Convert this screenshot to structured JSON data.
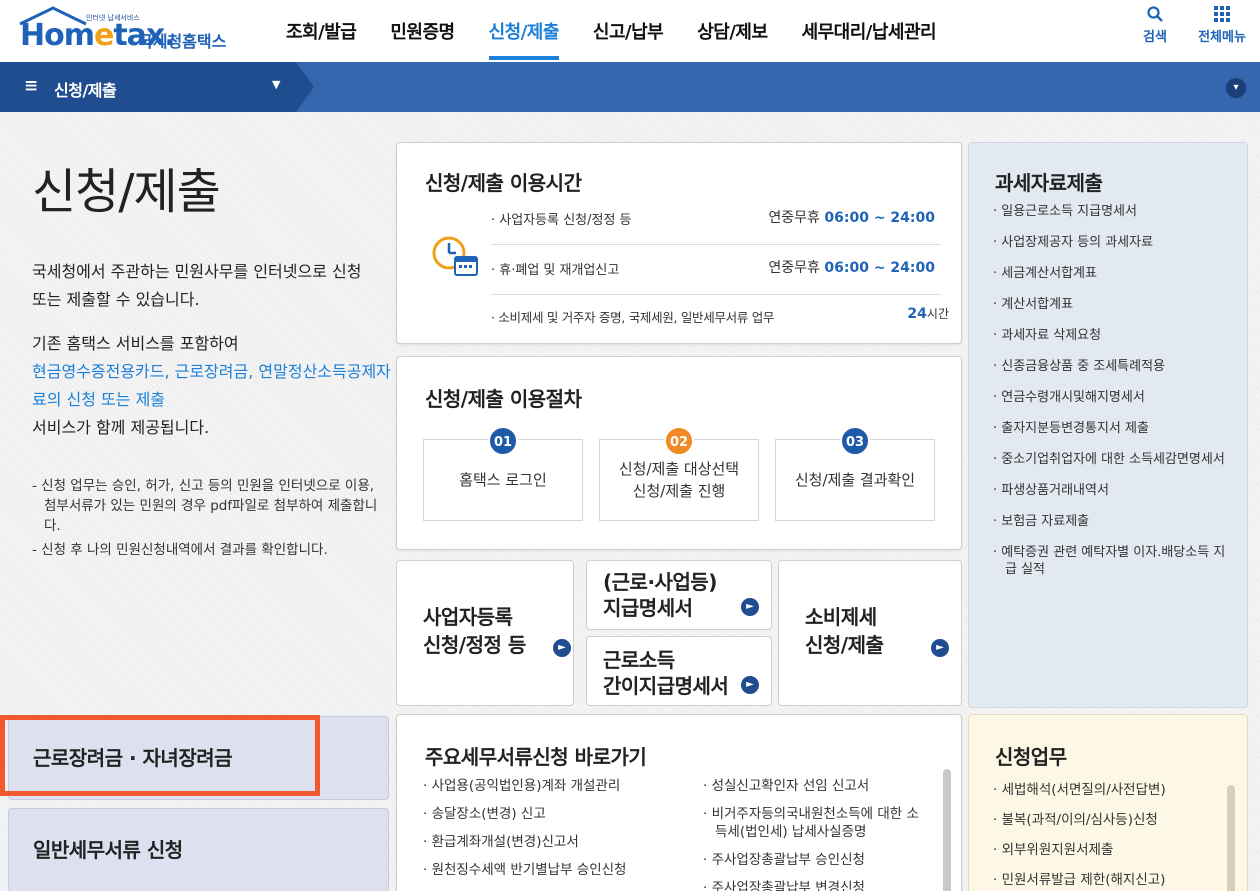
{
  "logo": {
    "tagline": "인터넷 납세서비스",
    "word_a": "Hom",
    "word_e": "e",
    "word_b": "tax.",
    "korean": "국세청홈택스"
  },
  "nav": {
    "items": [
      "조회/발급",
      "민원증명",
      "신청/제출",
      "신고/납부",
      "상담/제보",
      "세무대리/납세관리"
    ],
    "active_index": 2
  },
  "util": {
    "search": "검색",
    "all_menu": "전체메뉴"
  },
  "subbar": {
    "title": "신청/제출"
  },
  "intro": {
    "heading": "신청/제출",
    "p1": "국세청에서 주관하는 민원사무를 인터넷으로 신청 또는 제출할 수 있습니다.",
    "p2_pre": "기존 홈택스 서비스를 포함하여",
    "p2_blue": "현금영수증전용카드, 근로장려금, 연말정산소득공제자료의 신청 또는 제출",
    "p2_post": "서비스가 함께 제공됩니다.",
    "notes": [
      "- 신청 업무는 승인, 허가, 신고 등의 민원을 인터넷으로 이용, 첨부서류가 있는 민원의 경우 pdf파일로 첨부하여 제출합니다.",
      "- 신청 후 나의 민원신청내역에서 결과를 확인합니다."
    ]
  },
  "usage_time": {
    "title": "신청/제출 이용시간",
    "rows": [
      {
        "label": "· 사업자등록 신청/정정 등",
        "prefix": "연중무휴 ",
        "time": "06:00 ~ 24:00"
      },
      {
        "label": "· 휴·폐업 및 재개업신고",
        "prefix": "연중무휴 ",
        "time": "06:00 ~ 24:00"
      },
      {
        "label": "· 소비제세 및 거주자 증명, 국제세원, 일반세무서류 업무",
        "prefix": "",
        "time": "24",
        "suffix": "시간"
      }
    ]
  },
  "procedure": {
    "title": "신청/제출 이용절차",
    "steps": [
      {
        "num": "01",
        "text": "홈택스 로그인"
      },
      {
        "num": "02",
        "text": "신청/제출 대상선택\n신청/제출 진행"
      },
      {
        "num": "03",
        "text": "신청/제출 결과확인"
      }
    ]
  },
  "quick": {
    "business": "사업자등록\n신청/정정 등",
    "payment_statement": "(근로·사업등)\n지급명세서",
    "simple_statement": "근로소득\n간이지급명세서",
    "consumption": "소비제세\n신청/제출",
    "go_icon": "arrow-right-circle-icon"
  },
  "tax_data": {
    "title": "과세자료제출",
    "items": [
      "· 일용근로소득 지급명세서",
      "· 사업장제공자 등의 과세자료",
      "· 세금계산서합계표",
      "· 계산서합계표",
      "· 과세자료 삭제요청",
      "· 신종금융상품 중 조세특례적용",
      "· 연금수령개시및해지명세서",
      "· 출자지분등변경통지서 제출",
      "· 중소기업취업자에 대한 소득세감면명세서",
      "· 파생상품거래내역서",
      "· 보험금 자료제출",
      "· 예탁증권 관련 예탁자별 이자.배당소득 지급 실적"
    ]
  },
  "left_buttons": {
    "earned_credit": "근로장려금 · 자녀장려금",
    "general_docs": "일반세무서류 신청"
  },
  "shortcut": {
    "title": "주요세무서류신청 바로가기",
    "col1": [
      "· 사업용(공익법인용)계좌 개설관리",
      "· 송달장소(변경) 신고",
      "· 환급계좌개설(변경)신고서",
      "· 원천징수세액 반기별납부 승인신청"
    ],
    "col2": [
      "· 성실신고확인자 선임 신고서",
      "· 비거주자등의국내원천소득에 대한 소득세(법인세) 납세사실증명",
      "· 주사업장총괄납부 승인신청",
      "· 주사업장총괄납부 변경신청"
    ]
  },
  "apply_work": {
    "title": "신청업무",
    "items": [
      "· 세법해석(서면질의/사전답변)",
      "· 불복(과적/이의/심사등)신청",
      "· 외부위원지원서제출",
      "· 민원서류발급 제한(해지신고)"
    ]
  },
  "colors": {
    "primary": "#1e63b8",
    "active_nav": "#1c7fd9",
    "subbar": "#3467ad",
    "highlight": "#f25a2e",
    "step2": "#f08a24"
  }
}
